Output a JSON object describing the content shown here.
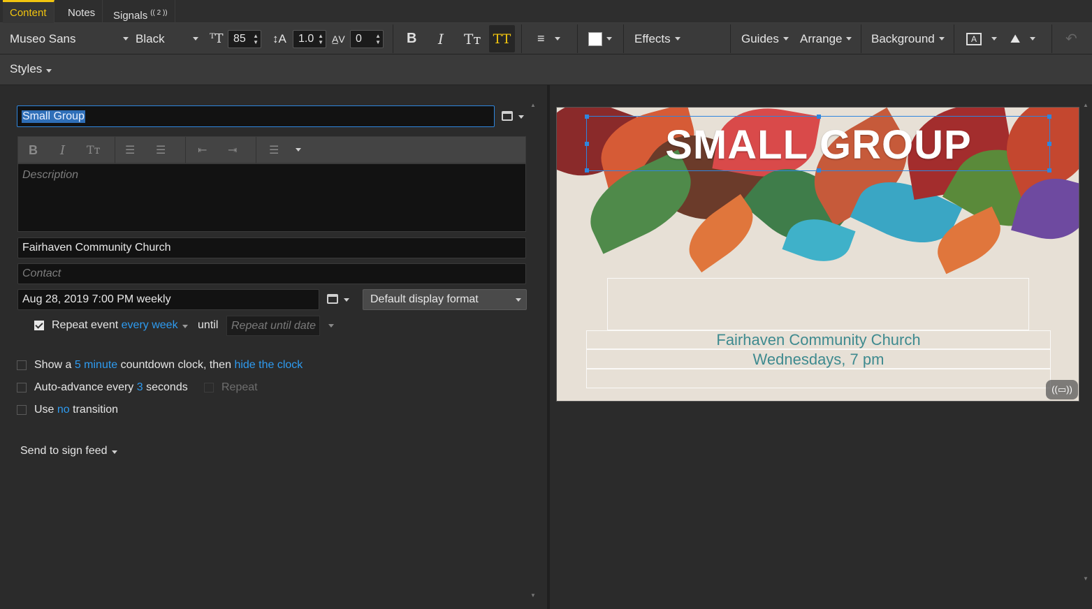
{
  "tabs": [
    {
      "label": "Content"
    },
    {
      "label": "Notes"
    },
    {
      "label": "Signals",
      "badge": "(( 2 ))"
    }
  ],
  "toolbar": {
    "font_family": "Museo Sans",
    "font_weight": "Black",
    "font_size": "85",
    "line_height": "1.0",
    "letter_spacing": "0",
    "effects": "Effects",
    "guides": "Guides",
    "arrange": "Arrange",
    "background": "Background"
  },
  "styles_label": "Styles",
  "form": {
    "title_value": "Small Group",
    "description_placeholder": "Description",
    "location_value": "Fairhaven Community Church",
    "contact_placeholder": "Contact",
    "date_value": "Aug 28, 2019 7:00 PM weekly",
    "display_format": "Default display format",
    "repeat_event_label": "Repeat event",
    "repeat_interval": "every week",
    "until_label": "until",
    "until_placeholder": "Repeat until date",
    "countdown": {
      "pre": "Show a",
      "amount": "5 minute",
      "mid": "countdown clock, then",
      "action": "hide the clock"
    },
    "auto_advance": {
      "pre": "Auto-advance every",
      "amount": "3",
      "post": "seconds",
      "repeat": "Repeat"
    },
    "transition": {
      "pre": "Use",
      "value": "no",
      "post": "transition"
    },
    "send_feed": "Send to sign feed"
  },
  "slide": {
    "title": "SMALL GROUP",
    "line1": "Fairhaven Community Church",
    "line2": "Wednesdays, 7 pm"
  },
  "colors": {
    "accent": "#f1c40f",
    "link": "#2e9bf0",
    "selection": "#2e86de",
    "slide_text": "#3e8a8f"
  }
}
